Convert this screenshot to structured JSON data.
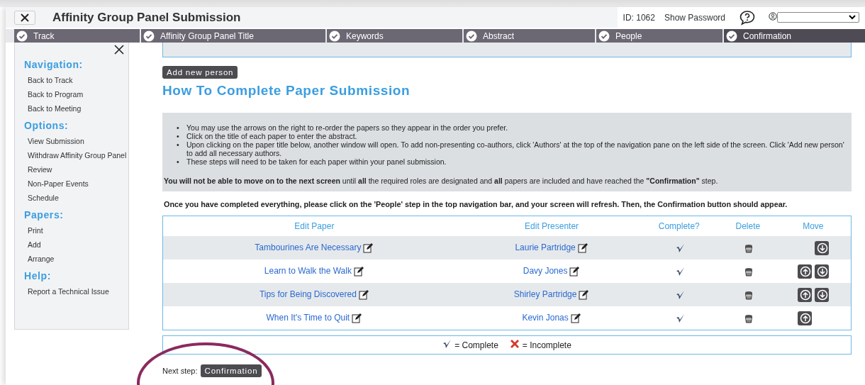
{
  "window": {
    "title": "Affinity Group Panel Submission"
  },
  "header": {
    "id_label": "ID: 1062",
    "show_password": "Show Password"
  },
  "tabs": [
    {
      "label": "Track",
      "complete": true,
      "selected": false
    },
    {
      "label": "Affinity Group Panel Title",
      "complete": true,
      "selected": false
    },
    {
      "label": "Keywords",
      "complete": true,
      "selected": false
    },
    {
      "label": "Abstract",
      "complete": true,
      "selected": false
    },
    {
      "label": "People",
      "complete": true,
      "selected": false
    },
    {
      "label": "Confirmation",
      "complete": true,
      "selected": true
    }
  ],
  "sidebar": {
    "sections": [
      {
        "title": "Navigation:",
        "items": [
          "Back to Track",
          "Back to Program",
          "Back to Meeting"
        ]
      },
      {
        "title": "Options:",
        "items": [
          "View Submission",
          "Withdraw Affinity Group Panel",
          "Review",
          "Non-Paper Events",
          "Schedule"
        ]
      },
      {
        "title": "Papers:",
        "items": [
          "Print",
          "Add",
          "Arrange"
        ]
      },
      {
        "title": "Help:",
        "items": [
          "Report a Technical Issue"
        ]
      }
    ]
  },
  "add_person_button": "Add new person",
  "heading": "How To Complete Paper Submission",
  "instructions": {
    "bullets": [
      {
        "marker": "•",
        "text": "You may use the arrows on the right to re-order the papers so they appear in the order you prefer."
      },
      {
        "marker": "•",
        "text": "Click on the title of each paper to enter the abstract."
      },
      {
        "marker": "•",
        "text": "Upon clicking on the paper title below, another window will open. To add non-presenting co-authors, click 'Authors' at the top of the navigation pane on the left side of the screen. Click 'Add new person' to add all necessary authors."
      },
      {
        "marker": "•",
        "text": "These steps will need to be taken for each paper within your panel submission."
      }
    ],
    "note": "**You will not be able to move on to the next screen** until **all** the required roles are designated and **all** papers are included and have reached the **\"Confirmation\"** step."
  },
  "notice": "Once you have completed everything, please click on the 'People' step in the top navigation bar, and your screen will refresh. Then, the Confirmation button should appear.",
  "table": {
    "columns": [
      "Edit Paper",
      "Edit Presenter",
      "Complete?",
      "Delete",
      "Move"
    ],
    "rows": [
      {
        "paper": "Tambourines Are Necessary",
        "presenter": "Laurie Partridge",
        "complete": true,
        "move_up": false,
        "move_down": true
      },
      {
        "paper": "Learn to Walk the Walk",
        "presenter": "Davy Jones",
        "complete": true,
        "move_up": true,
        "move_down": true
      },
      {
        "paper": "Tips for Being Discovered",
        "presenter": "Shirley Partridge",
        "complete": true,
        "move_up": true,
        "move_down": true
      },
      {
        "paper": "When It's Time to Quit",
        "presenter": "Kevin Jonas",
        "complete": true,
        "move_up": true,
        "move_down": false
      }
    ]
  },
  "legend": {
    "complete": "= Complete",
    "incomplete": "= Incomplete"
  },
  "next_step": {
    "label": "Next step:",
    "button": "Confirmation"
  }
}
